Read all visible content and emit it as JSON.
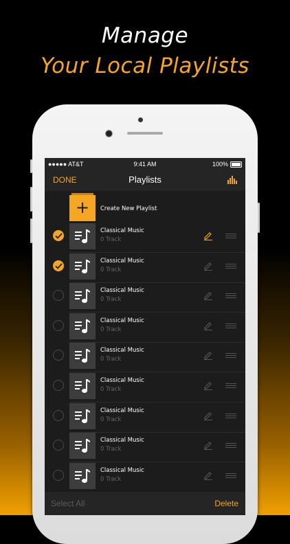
{
  "headline": {
    "line1": "Manage",
    "line2": "Your Local Playlists"
  },
  "status_bar": {
    "carrier": "●●●●● AT&T",
    "time": "9:41 AM",
    "battery": "100%"
  },
  "nav": {
    "done": "DONE",
    "title": "Playlists"
  },
  "create_row": {
    "plus": "+",
    "label": "Create New Playlist"
  },
  "playlists": [
    {
      "title": "Classical Music",
      "subtitle": "0 Track",
      "checked": true,
      "edit_active": true
    },
    {
      "title": "Classical Music",
      "subtitle": "0 Track",
      "checked": true,
      "edit_active": false
    },
    {
      "title": "Classical Music",
      "subtitle": "0 Track",
      "checked": false,
      "edit_active": false
    },
    {
      "title": "Classical Music",
      "subtitle": "0 Track",
      "checked": false,
      "edit_active": false
    },
    {
      "title": "Classical Music",
      "subtitle": "0 Track",
      "checked": false,
      "edit_active": false
    },
    {
      "title": "Classical Music",
      "subtitle": "0 Track",
      "checked": false,
      "edit_active": false
    },
    {
      "title": "Classical Music",
      "subtitle": "0 Track",
      "checked": false,
      "edit_active": false
    },
    {
      "title": "Classical Music",
      "subtitle": "0 Track",
      "checked": false,
      "edit_active": false
    },
    {
      "title": "Classical Music",
      "subtitle": "0 Track",
      "checked": false,
      "edit_active": false
    }
  ],
  "toolbar": {
    "select_all": "Select All",
    "delete": "Delete"
  },
  "colors": {
    "accent": "#f5a623",
    "background": "#1c1c1c"
  },
  "icons": {
    "check": "checkmark-icon",
    "thumb": "music-note-icon",
    "edit": "pencil-icon",
    "reorder": "reorder-handle-icon",
    "equalizer": "equalizer-icon"
  }
}
